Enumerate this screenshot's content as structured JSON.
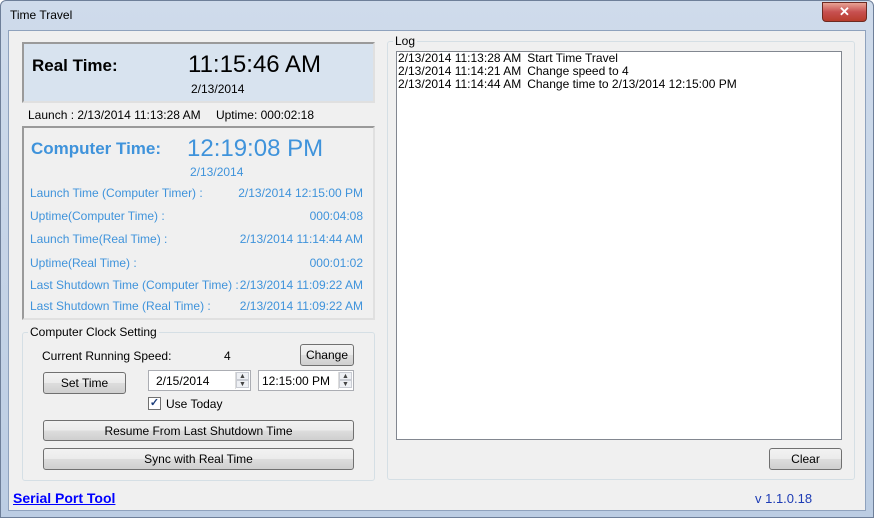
{
  "window": {
    "title": "Time Travel",
    "close_glyph": "✕"
  },
  "real": {
    "label": "Real Time:",
    "time": "11:15:46 AM",
    "date": "2/13/2014"
  },
  "status": {
    "launch": "Launch : 2/13/2014 11:13:28 AM",
    "uptime": "Uptime: 000:02:18"
  },
  "computer": {
    "label": "Computer Time:",
    "time": "12:19:08 PM",
    "date": "2/13/2014",
    "rows": [
      {
        "key": "Launch Time (Computer Timer) :",
        "value": "2/13/2014 12:15:00 PM"
      },
      {
        "key": "Uptime(Computer Time) :",
        "value": "000:04:08"
      },
      {
        "key": "Launch Time(Real Time) :",
        "value": "2/13/2014 11:14:44 AM"
      },
      {
        "key": "Uptime(Real Time) :",
        "value": "000:01:02"
      },
      {
        "key": "Last Shutdown Time (Computer Time) :",
        "value": "2/13/2014 11:09:22 AM"
      },
      {
        "key": "Last Shutdown Time (Real Time) :",
        "value": "2/13/2014 11:09:22 AM"
      }
    ],
    "color": "#3f93db"
  },
  "clock_setting": {
    "caption": "Computer Clock Setting",
    "speed_label": "Current Running Speed:",
    "speed_value": "4",
    "change_label": "Change",
    "set_time_label": "Set Time",
    "date_value": "2/15/2014",
    "time_value": "12:15:00 PM",
    "use_today_label": "Use Today",
    "use_today_checked": true,
    "resume_label": "Resume From Last Shutdown Time",
    "sync_label": "Sync with Real Time"
  },
  "log": {
    "caption": "Log",
    "entries": [
      {
        "ts": "2/13/2014 11:13:28 AM",
        "msg": "Start Time Travel"
      },
      {
        "ts": "2/13/2014 11:14:21 AM",
        "msg": "Change speed to 4"
      },
      {
        "ts": "2/13/2014 11:14:44 AM",
        "msg": "Change time to 2/13/2014 12:15:00 PM"
      }
    ],
    "clear_label": "Clear"
  },
  "footer": {
    "link_label": "Serial Port Tool",
    "version": "v 1.1.0.18"
  }
}
